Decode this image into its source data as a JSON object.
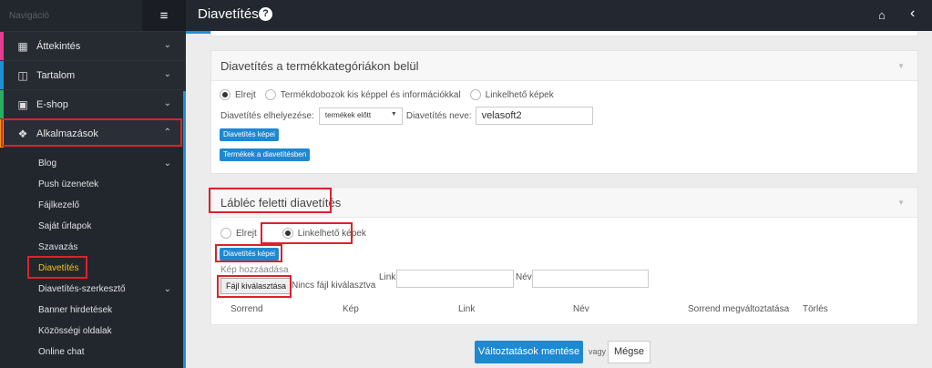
{
  "sidebar": {
    "title": "Navigáció",
    "menu": [
      {
        "label": "Áttekintés",
        "icon": "grid-icon",
        "stripe": "#e73c8f"
      },
      {
        "label": "Tartalom",
        "icon": "book-icon",
        "stripe": "#1e90d6"
      },
      {
        "label": "E-shop",
        "icon": "basket-icon",
        "stripe": "#27ae60"
      },
      {
        "label": "Alkalmazások",
        "icon": "cubes-icon",
        "stripe": "#f39c12"
      }
    ],
    "submenu": [
      "Blog",
      "Push üzenetek",
      "Fájlkezelő",
      "Saját űrlapok",
      "Szavazás",
      "Diavetítés",
      "Diavetítés-szerkesztő",
      "Banner hirdetések",
      "Közösségi oldalak",
      "Online chat"
    ],
    "current_item": "Diavetítés",
    "highlight_color": "#d9232d"
  },
  "header": {
    "title": "Diavetítés",
    "help_glyph": "?",
    "accent": "#1e90d6"
  },
  "panel1": {
    "title": "Diavetítés a termékkategóriákon belül",
    "radios": [
      "Elrejt",
      "Termékdobozok kis képpel és információkkal",
      "Linkelhető képek"
    ],
    "selected_radio": "Elrejt",
    "placement_label": "Diavetítés elhelyezése:",
    "placement_value": "termékek előtt",
    "name_label": "Diavetítés neve:",
    "name_value": "velasoft2",
    "btn_images": "Diavetítés képei",
    "btn_products": "Termékek a diavetítésben"
  },
  "panel2": {
    "title": "Lábléc feletti diavetítés",
    "radios": [
      "Elrejt",
      "Linkelhető képek"
    ],
    "selected_radio": "Linkelhető képek",
    "btn_images": "Diavetítés képei",
    "add_image_label": "Kép hozzáadása",
    "file_button": "Fájl kiválasztása",
    "no_file": "Nincs fájl kiválasztva",
    "link_label": "Link",
    "name_label": "Név",
    "table_headers": [
      "Sorrend",
      "Kép",
      "Link",
      "Név",
      "Sorrend megváltoztatása",
      "Törlés"
    ]
  },
  "footer": {
    "save": "Változtatások mentése",
    "or": "vagy",
    "cancel": "Mégse"
  }
}
